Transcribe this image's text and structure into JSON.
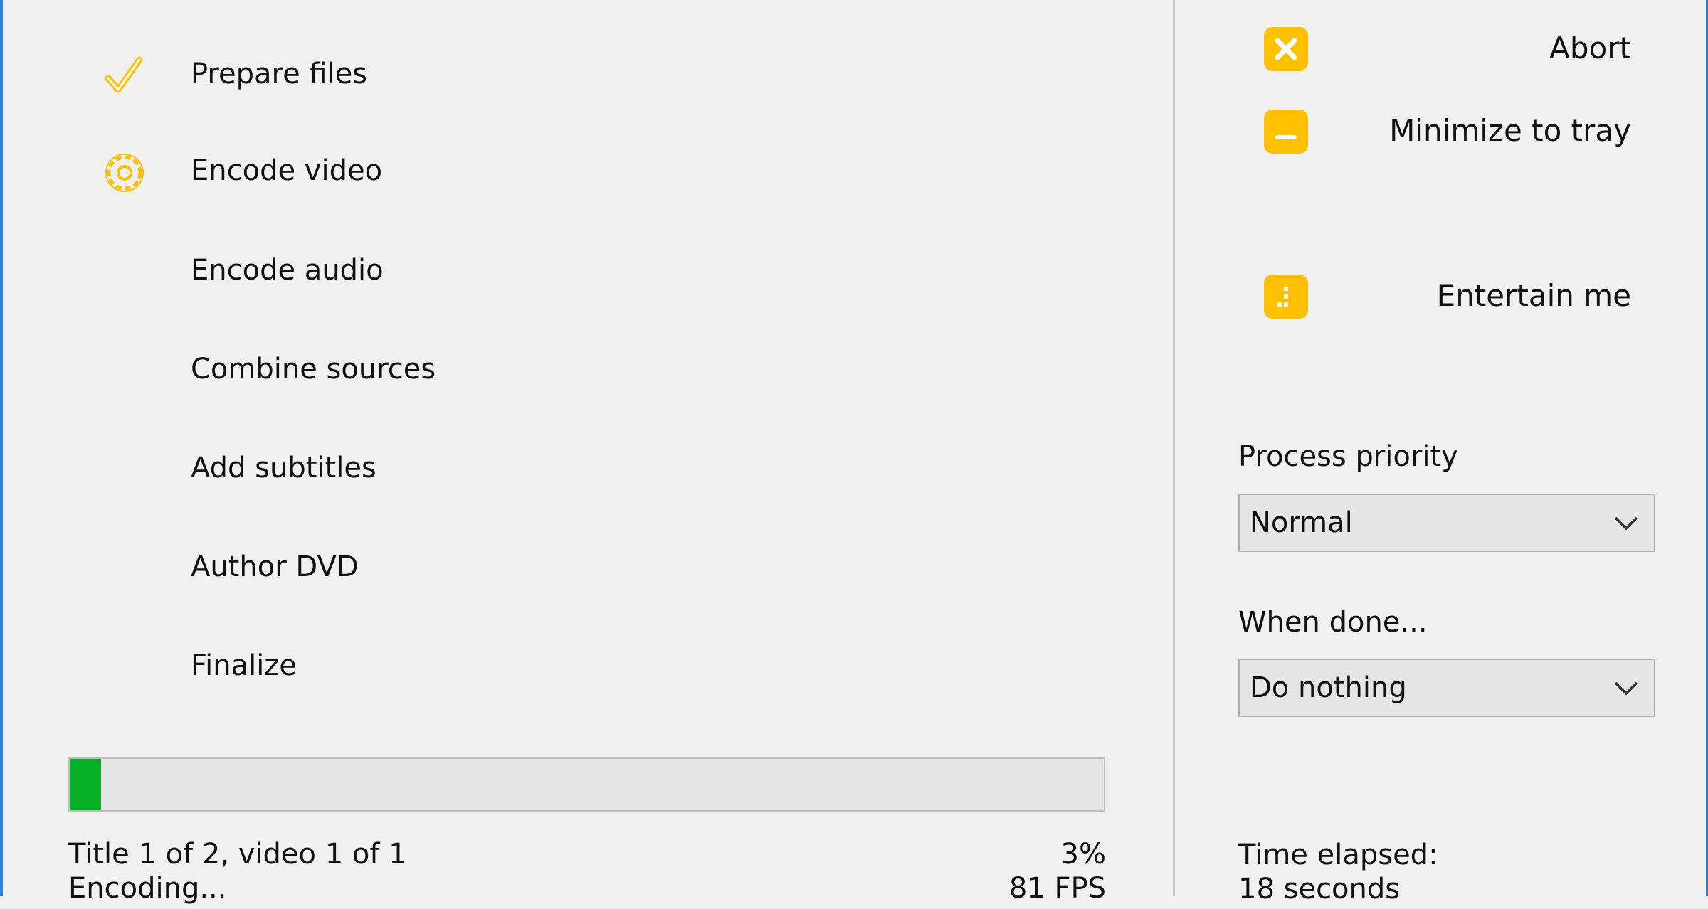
{
  "steps": [
    {
      "label": "Prepare files",
      "icon": "checkmark-icon",
      "status": "done"
    },
    {
      "label": "Encode video",
      "icon": "gear-icon",
      "status": "active"
    },
    {
      "label": "Encode audio",
      "icon": "",
      "status": "pending"
    },
    {
      "label": "Combine sources",
      "icon": "",
      "status": "pending"
    },
    {
      "label": "Add subtitles",
      "icon": "",
      "status": "pending"
    },
    {
      "label": "Author DVD",
      "icon": "",
      "status": "pending"
    },
    {
      "label": "Finalize",
      "icon": "",
      "status": "pending"
    }
  ],
  "progress": {
    "value": 0.03,
    "percent_text": "3%",
    "fill_color": "#06b025"
  },
  "status": {
    "title_text": "Title 1 of 2, video 1 of 1",
    "phase_text": "Encoding...",
    "fps_text": "81 FPS"
  },
  "actions": {
    "abort_label": "Abort",
    "minimize_label": "Minimize to tray",
    "entertain_label": "Entertain me"
  },
  "priority": {
    "label": "Process priority",
    "selected": "Normal"
  },
  "when_done": {
    "label": "When done...",
    "selected": "Do nothing"
  },
  "elapsed": {
    "label": "Time elapsed:",
    "value": "18 seconds"
  },
  "colors": {
    "accent_yellow": "#ffc000",
    "window_border": "#2f7fd6",
    "progress_green": "#06b025"
  }
}
